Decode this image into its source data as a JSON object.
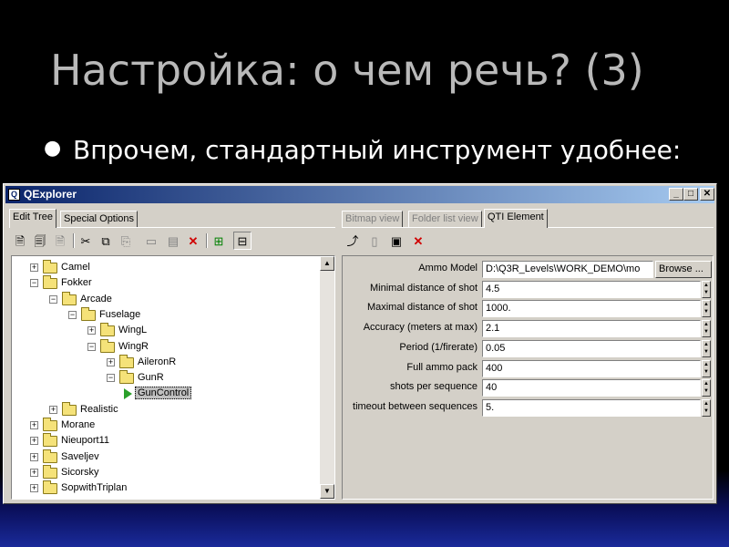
{
  "slide": {
    "title": "Настройка: о чем речь? (3)",
    "bullet": "Впрочем, стандартный инструмент удобнее:"
  },
  "window": {
    "title": "QExplorer",
    "icon": "app-icon",
    "controls": {
      "minimize": "_",
      "maximize": "□",
      "close": "✕"
    }
  },
  "left_tabs": [
    "Edit Tree",
    "Special Options"
  ],
  "right_tabs": [
    "Bitmap view",
    "Folder list view",
    "QTI Element"
  ],
  "tree": [
    {
      "label": "Camel",
      "level": 0,
      "expander": "+"
    },
    {
      "label": "Fokker",
      "level": 0,
      "expander": "−"
    },
    {
      "label": "Arcade",
      "level": 1,
      "expander": "−"
    },
    {
      "label": "Fuselage",
      "level": 2,
      "expander": "−"
    },
    {
      "label": "WingL",
      "level": 3,
      "expander": "+"
    },
    {
      "label": "WingR",
      "level": 3,
      "expander": "−"
    },
    {
      "label": "AileronR",
      "level": 4,
      "expander": "+"
    },
    {
      "label": "GunR",
      "level": 4,
      "expander": "−"
    },
    {
      "label": "GunControl",
      "level": 5,
      "expander": ""
    },
    {
      "label": "Realistic",
      "level": 1,
      "expander": "+"
    },
    {
      "label": "Morane",
      "level": 0,
      "expander": "+"
    },
    {
      "label": "Nieuport11",
      "level": 0,
      "expander": "+"
    },
    {
      "label": "Saveljev",
      "level": 0,
      "expander": "+"
    },
    {
      "label": "Sicorsky",
      "level": 0,
      "expander": "+"
    },
    {
      "label": "SopwithTriplan",
      "level": 0,
      "expander": "+"
    }
  ],
  "props": [
    {
      "label": "Ammo Model",
      "value": "D:\\Q3R_Levels\\WORK_DEMO\\mo",
      "button": "Browse ..."
    },
    {
      "label": "Minimal distance of shot",
      "value": "4.5"
    },
    {
      "label": "Maximal distance of shot",
      "value": "1000."
    },
    {
      "label": "Accuracy (meters at max)",
      "value": "2.1"
    },
    {
      "label": "Period (1/firerate)",
      "value": "0.05"
    },
    {
      "label": "Full ammo pack",
      "value": "400"
    },
    {
      "label": "shots per sequence",
      "value": "40"
    },
    {
      "label": "timeout between sequences",
      "value": "5."
    }
  ]
}
